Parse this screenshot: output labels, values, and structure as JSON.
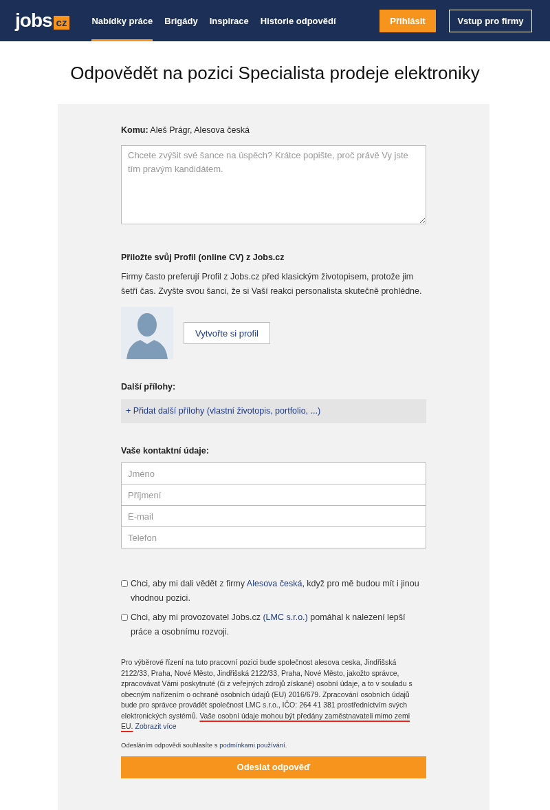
{
  "header": {
    "logo": {
      "word": "jobs",
      "badge": "cz"
    },
    "nav": [
      {
        "label": "Nabídky práce",
        "selected": true
      },
      {
        "label": "Brigády",
        "selected": false
      },
      {
        "label": "Inspirace",
        "selected": false
      },
      {
        "label": "Historie odpovědí",
        "selected": false
      }
    ],
    "login_button": "Přihlásit",
    "company_button": "Vstup pro firmy"
  },
  "page_title": "Odpovědět na pozici Specialista prodeje elektroniky",
  "recipient": {
    "label": "Komu:",
    "value": "Aleš Prágr, Alesova česká"
  },
  "message": {
    "placeholder": "Chcete zvýšit své šance na úspěch? Krátce popište, proč právě Vy jste tím pravým kandidátem."
  },
  "profile": {
    "heading": "Přiložte svůj Profil (online CV) z Jobs.cz",
    "text": "Firmy často preferují Profil z Jobs.cz před klasickým životopisem, protože jim šetří čas. Zvyšte svou šanci, že si Vaší reakci personalista skutečně prohlédne.",
    "button": "Vytvořte si profil"
  },
  "attachments": {
    "heading": "Další přílohy:",
    "add_link": "+ Přidat další přílohy (vlastní životopis, portfolio, ...)"
  },
  "contact": {
    "heading": "Vaše kontaktní údaje:",
    "fields": [
      {
        "placeholder": "Jméno"
      },
      {
        "placeholder": "Příjmení"
      },
      {
        "placeholder": "E-mail"
      },
      {
        "placeholder": "Telefon"
      }
    ]
  },
  "consents": [
    {
      "checked": false,
      "segments": [
        {
          "kind": "text",
          "text": "Chci, aby mi dali vědět z firmy "
        },
        {
          "kind": "link",
          "text": "Alesova česká"
        },
        {
          "kind": "text",
          "text": ", když pro mě budou mít i jinou vhodnou pozici."
        }
      ]
    },
    {
      "checked": false,
      "segments": [
        {
          "kind": "text",
          "text": "Chci, aby mi provozovatel Jobs.cz "
        },
        {
          "kind": "link",
          "text": "(LMC s.r.o.)"
        },
        {
          "kind": "text",
          "text": " pomáhal k nalezení lepší práce a osobnímu rozvoji."
        }
      ]
    }
  ],
  "legal": {
    "segments": [
      {
        "kind": "text",
        "text": "Pro výběrové řízení na tuto pracovní pozici bude společnost alesova ceska, Jindřišská 2122/33, Praha, Nové Město, Jindřišská 2122/33, Praha, Nové Město, jakožto správce, zpracovávat Vámi poskytnuté (či z veřejných zdrojů získané) osobní údaje, a to v souladu s obecným nařízením o ochraně osobních údajů (EU) 2016/679. Zpracování osobních údajů bude pro správce provádět společnost LMC s.r.o., IČO: 264 41 381 prostřednictvím svých elektronických systémů. "
      },
      {
        "kind": "underlined",
        "text": "Vaše osobní údaje mohou být předány zaměstnavateli mimo zemi EU."
      },
      {
        "kind": "link",
        "text": "Zobrazit více"
      }
    ]
  },
  "terms": {
    "segments": [
      {
        "kind": "text",
        "text": "Odesláním odpovědi souhlasíte s "
      },
      {
        "kind": "link",
        "text": "podmínkami používání"
      },
      {
        "kind": "text",
        "text": "."
      }
    ]
  },
  "submit_button": "Odeslat odpověď"
}
